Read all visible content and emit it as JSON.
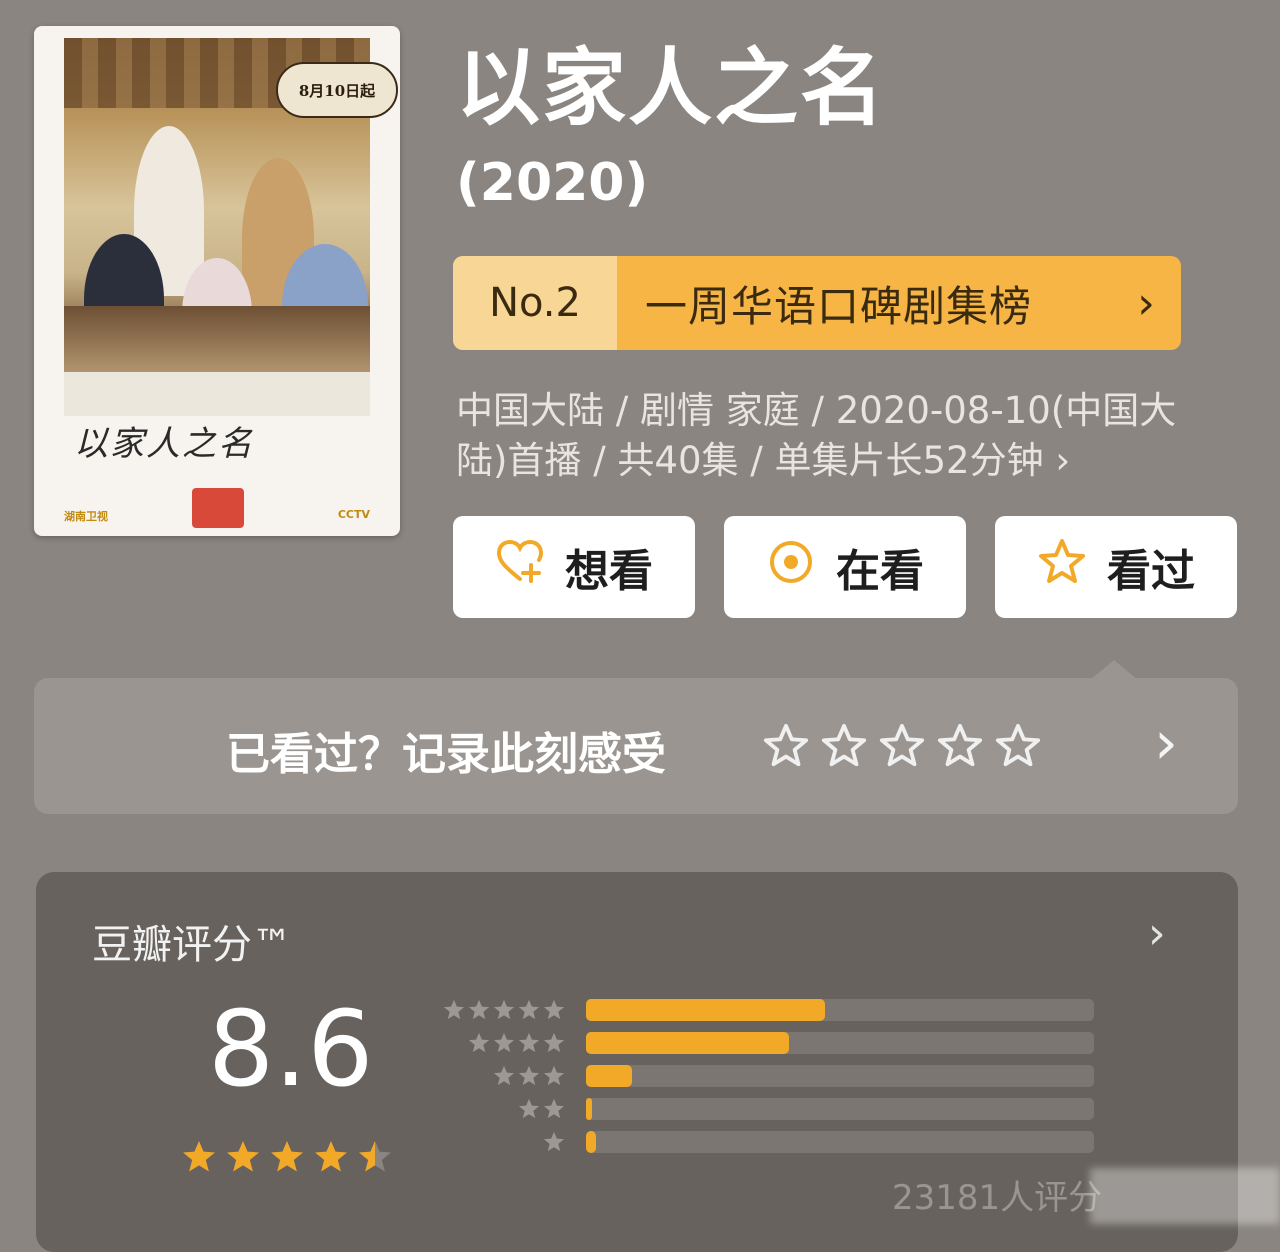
{
  "poster": {
    "date_badge": "8月10日起",
    "title_art": "以家人之名",
    "footer_left": "湖南卫视",
    "footer_right": "CCTV"
  },
  "header": {
    "title": "以家人之名",
    "year": "(2020)"
  },
  "rank": {
    "number": "No.2",
    "label": "一周华语口碑剧集榜",
    "chevron": "›"
  },
  "meta": {
    "text": "中国大陆 / 剧情 家庭 / 2020-08-10(中国大陆)首播 / 共40集 / 单集片长52分钟 ›"
  },
  "actions": [
    {
      "label": "想看",
      "icon": "heart-plus-icon"
    },
    {
      "label": "在看",
      "icon": "target-circle-icon"
    },
    {
      "label": "看过",
      "icon": "star-outline-icon"
    }
  ],
  "record": {
    "prompt": "已看过？记录此刻感受",
    "chevron": "›"
  },
  "rating": {
    "label": "豆瓣评分™",
    "chevron": "›",
    "score": "8.6",
    "stars": 4.5,
    "distribution": [
      {
        "stars": 5,
        "fraction": 0.47
      },
      {
        "stars": 4,
        "fraction": 0.4
      },
      {
        "stars": 3,
        "fraction": 0.09
      },
      {
        "stars": 2,
        "fraction": 0.01
      },
      {
        "stars": 1,
        "fraction": 0.02
      }
    ],
    "count": "23181人评分"
  },
  "colors": {
    "background": "#8a8580",
    "accent": "#f3a928",
    "rank_bg": "#f7b545",
    "rank_no_bg": "#f8d696"
  }
}
